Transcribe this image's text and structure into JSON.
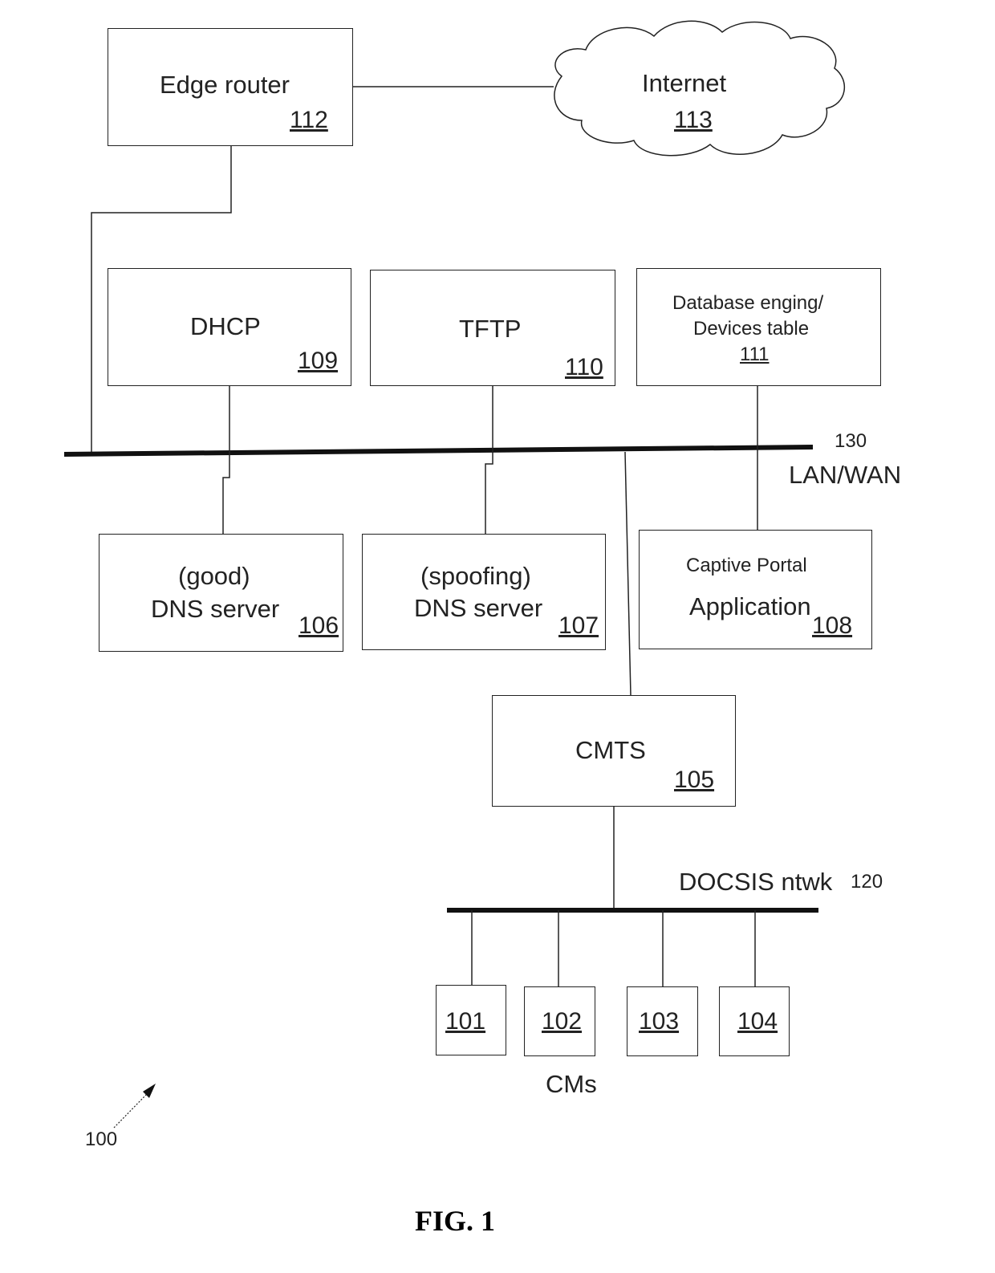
{
  "figure": {
    "caption": "FIG. 1",
    "system_ref": "100"
  },
  "nodes": {
    "edge_router": {
      "label": "Edge router",
      "ref": "112"
    },
    "internet": {
      "label": "Internet",
      "ref": "113"
    },
    "dhcp": {
      "label": "DHCP",
      "ref": "109"
    },
    "tftp": {
      "label": "TFTP",
      "ref": "110"
    },
    "database": {
      "label_line1": "Database enging/",
      "label_line2": "Devices table",
      "ref": "111"
    },
    "good_dns": {
      "label_line1": "(good)",
      "label_line2": "DNS server",
      "ref": "106"
    },
    "spoof_dns": {
      "label_line1": "(spoofing)",
      "label_line2": "DNS server",
      "ref": "107"
    },
    "captive_portal": {
      "label_line1": "Captive Portal",
      "label_line2": "Application",
      "ref": "108"
    },
    "cmts": {
      "label": "CMTS",
      "ref": "105"
    },
    "cms": [
      {
        "ref": "101"
      },
      {
        "ref": "102"
      },
      {
        "ref": "103"
      },
      {
        "ref": "104"
      }
    ],
    "cms_label": "CMs"
  },
  "networks": {
    "lan_wan": {
      "ref": "130",
      "label": "LAN/WAN"
    },
    "docsis": {
      "label": "DOCSIS ntwk",
      "ref": "120"
    }
  }
}
